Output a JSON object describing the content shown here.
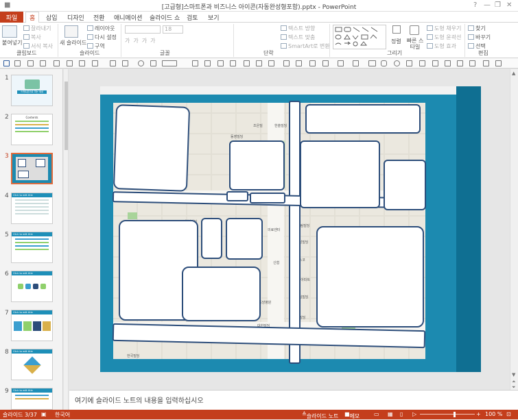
{
  "window": {
    "title": "[고급형]스마트폰과 비즈니스 아이콘(자동완성형포함).pptx - PowerPoint",
    "controls": [
      "?",
      "—",
      "❐",
      "✕"
    ]
  },
  "tabs": [
    "파일",
    "홈",
    "삽입",
    "디자인",
    "전환",
    "애니메이션",
    "슬라이드 쇼",
    "검토",
    "보기"
  ],
  "ribbon": {
    "clipboard": {
      "paste": "붙여넣기",
      "cut": "잘라내기",
      "copy": "복사",
      "format_painter": "서식 복사",
      "group": "클립보드"
    },
    "slides": {
      "new_slide": "새 슬라이드",
      "layout": "레이아웃",
      "reset": "다시 설정",
      "section": "구역",
      "group": "슬라이드"
    },
    "font": {
      "size": "18",
      "group": "글꼴"
    },
    "paragraph": {
      "text_direction": "텍스트 방향",
      "align_text": "텍스트 맞춤",
      "smartart": "SmartArt로 변환",
      "group": "단락"
    },
    "drawing": {
      "arrange": "정렬",
      "quick_styles": "빠른 스타일",
      "fill": "도형 채우기",
      "outline": "도형 윤곽선",
      "effects": "도형 효과",
      "group": "그리기"
    },
    "editing": {
      "find": "찾기",
      "replace": "바꾸기",
      "select": "선택",
      "group": "편집"
    }
  },
  "thumbnails": [
    {
      "num": "1",
      "caption": "스마트폰으로 여는 세상"
    },
    {
      "num": "2",
      "caption": "Contents"
    },
    {
      "num": "3",
      "caption": ""
    },
    {
      "num": "4",
      "caption": "Click to edit title"
    },
    {
      "num": "5",
      "caption": "Click to edit title"
    },
    {
      "num": "6",
      "caption": "Click to edit title"
    },
    {
      "num": "7",
      "caption": "Click to edit title"
    },
    {
      "num": "8",
      "caption": "Click to edit title"
    },
    {
      "num": "9",
      "caption": "Click to edit title"
    }
  ],
  "map_labels": [
    "조은빌",
    "한솔빌딩",
    "동영빌딩",
    "하남빌딩",
    "의료센터",
    "신협",
    "대림빌딩",
    "강남빌딩",
    "포스코",
    "한신아파트",
    "풍림빌딩",
    "현진빌딩",
    "대한빌딩",
    "한국빌딩",
    "중앙병원"
  ],
  "notes": {
    "placeholder": "여기에 슬라이드 노트의 내용을 입력하십시오"
  },
  "status": {
    "slide": "슬라이드 3/37",
    "language": "한국어",
    "notes": "슬라이드 노트",
    "comments": "메모",
    "zoom": "100 %"
  },
  "colors": {
    "accent": "#c43e1c",
    "slide_bg": "#1c8ab0",
    "box_border": "#2c4d7a"
  }
}
